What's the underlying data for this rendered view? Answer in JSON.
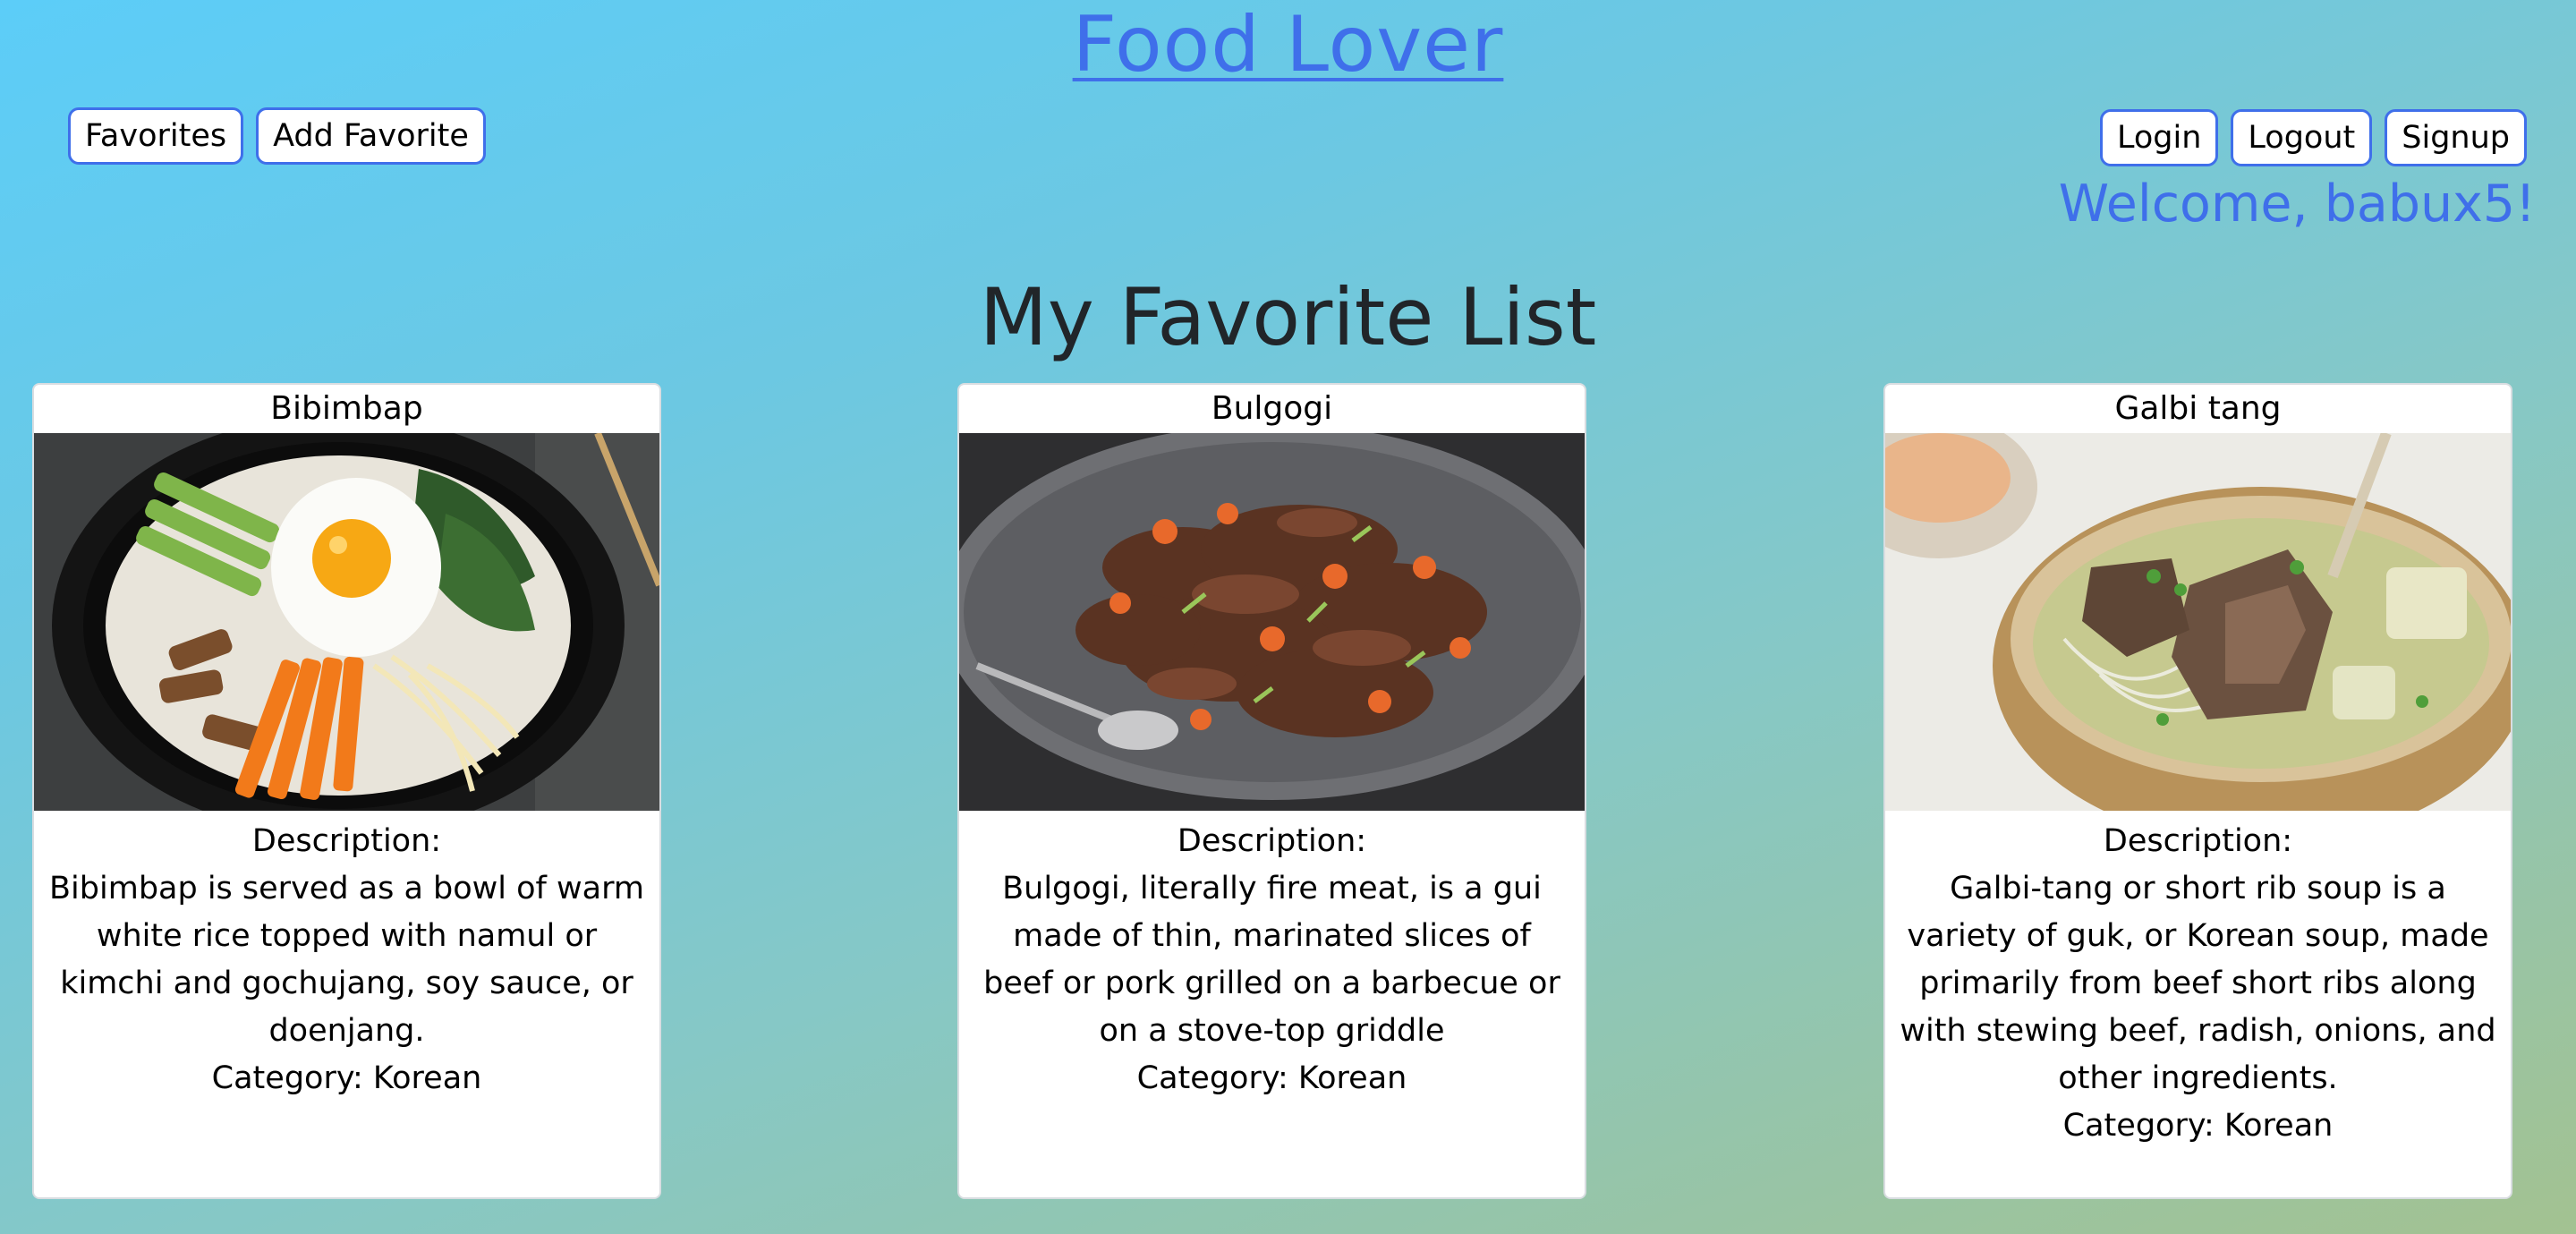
{
  "header": {
    "site_title": "Food Lover",
    "nav_left": [
      "Favorites",
      "Add Favorite"
    ],
    "nav_right": [
      "Login",
      "Logout",
      "Signup"
    ],
    "welcome": "Welcome, babux5!"
  },
  "main": {
    "heading": "My Favorite List",
    "cards": [
      {
        "title": "Bibimbap",
        "description_label": "Description:",
        "description": "Bibimbap is served as a bowl of warm white rice topped with namul or kimchi and gochujang, soy sauce, or doenjang.",
        "category": "Category: Korean",
        "image": "bibimbap-photo"
      },
      {
        "title": "Bulgogi",
        "description_label": "Description:",
        "description": "Bulgogi, literally fire meat, is a gui made of thin, marinated slices of beef or pork grilled on a barbecue or on a stove-top griddle",
        "category": "Category: Korean",
        "image": "bulgogi-photo"
      },
      {
        "title": "Galbi tang",
        "description_label": "Description:",
        "description": "Galbi-tang or short rib soup is a variety of guk, or Korean soup, made primarily from beef short ribs along with stewing beef, radish, onions, and other ingredients.",
        "category": "Category: Korean",
        "image": "galbi-tang-photo"
      }
    ]
  },
  "colors": {
    "accent": "#3f6fea",
    "text": "#212529",
    "card_bg": "#ffffff"
  }
}
